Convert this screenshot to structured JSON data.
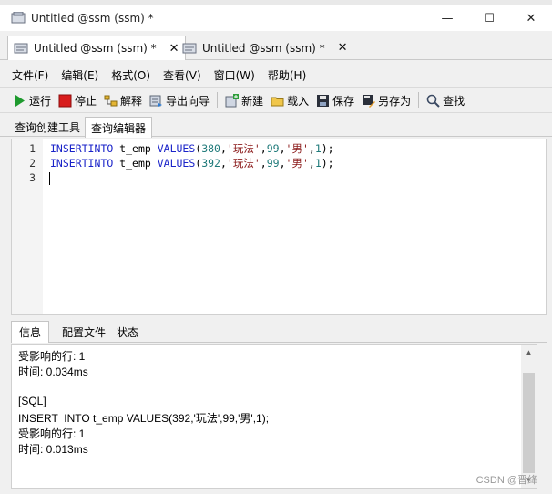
{
  "window": {
    "title": "Untitled @ssm (ssm) *",
    "controls": {
      "minimize": "—",
      "maximize": "☐",
      "close": "✕"
    }
  },
  "doc_tabs": [
    {
      "label": "Untitled @ssm (ssm) *",
      "close": "✕"
    },
    {
      "label": "Untitled @ssm (ssm) *",
      "close": "✕"
    }
  ],
  "menu": [
    "文件(F)",
    "编辑(E)",
    "格式(O)",
    "查看(V)",
    "窗口(W)",
    "帮助(H)"
  ],
  "toolbar": {
    "run": "运行",
    "stop": "停止",
    "explain": "解释",
    "export_wizard": "导出向导",
    "new": "新建",
    "load": "载入",
    "save": "保存",
    "save_as": "另存为",
    "find": "查找"
  },
  "sub_tabs": [
    "查询创建工具",
    "查询编辑器"
  ],
  "editor": {
    "line_numbers": [
      "1",
      "2",
      "3"
    ],
    "lines": [
      {
        "kw1": "INSERT",
        "kw2": "INTO",
        "table": " t_emp ",
        "kw3": "VALUES",
        "open": "(",
        "n1": "380",
        "c1": ",",
        "s1": "'玩法'",
        "c2": ",",
        "n2": "99",
        "c3": ",",
        "s2": "'男'",
        "c4": ",",
        "n3": "1",
        "close": ");"
      },
      {
        "kw1": "INSERT",
        "kw2": "INTO",
        "table": " t_emp ",
        "kw3": "VALUES",
        "open": "(",
        "n1": "392",
        "c1": ",",
        "s1": "'玩法'",
        "c2": ",",
        "n2": "99",
        "c3": ",",
        "s2": "'男'",
        "c4": ",",
        "n3": "1",
        "close": ");"
      }
    ]
  },
  "bottom_tabs": [
    "信息",
    "配置文件",
    "状态"
  ],
  "output_lines": [
    "受影响的行: 1",
    "时间: 0.034ms",
    "",
    "[SQL]",
    "INSERT  INTO t_emp VALUES(392,'玩法',99,'男',1);",
    "受影响的行: 1",
    "时间: 0.013ms"
  ],
  "watermark": "CSDN @晋绛",
  "colors": {
    "keyword": "#1a23c9",
    "number": "#1f7a7a",
    "string": "#8b1a1a"
  }
}
